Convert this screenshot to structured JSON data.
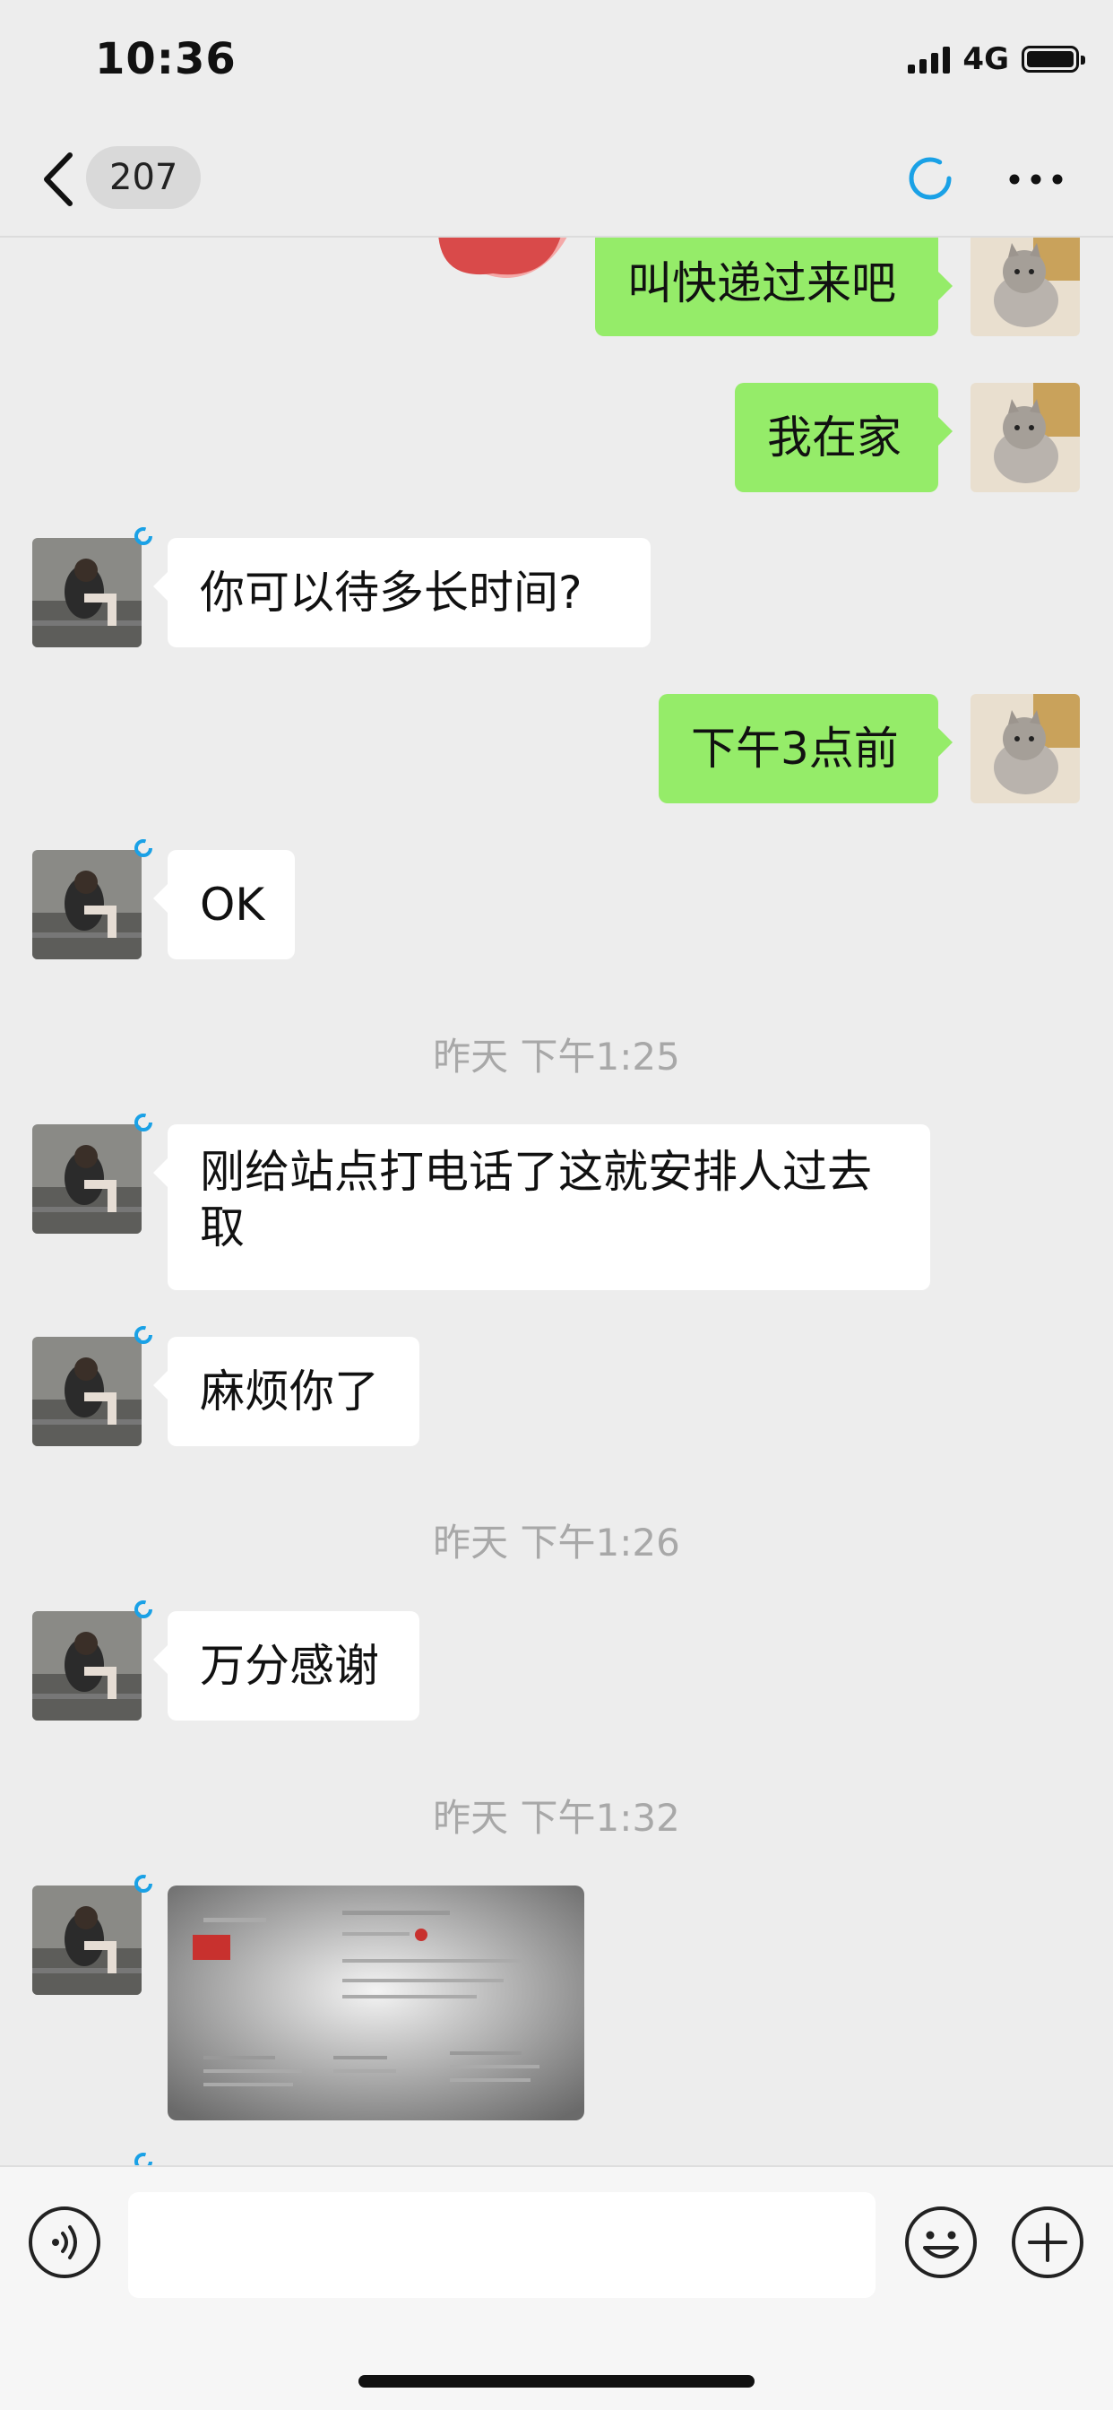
{
  "status_bar": {
    "time": "10:36",
    "network": "4G"
  },
  "nav": {
    "unread_count": "207"
  },
  "messages": [
    {
      "side": "out",
      "text": "叫快递过来吧"
    },
    {
      "side": "out",
      "text": "我在家"
    },
    {
      "side": "in",
      "text": "你可以待多长时间?"
    },
    {
      "side": "out",
      "text": "下午3点前"
    },
    {
      "side": "in",
      "text": "OK"
    },
    {
      "type": "time",
      "text": "昨天 下午1:25"
    },
    {
      "side": "in",
      "text": "刚给站点打电话了这就安排人过去取"
    },
    {
      "side": "in",
      "text": "麻烦你了"
    },
    {
      "type": "time",
      "text": "昨天 下午1:26"
    },
    {
      "side": "in",
      "text": "万分感谢"
    },
    {
      "type": "time",
      "text": "昨天 下午1:32"
    },
    {
      "side": "in",
      "type": "image"
    }
  ],
  "input": {
    "value": ""
  },
  "icons": {
    "back": "chevron-left-icon",
    "loading": "loading-ring-icon",
    "more": "more-dots-icon",
    "voice": "voice-icon",
    "emoji": "emoji-icon",
    "plus": "plus-icon"
  },
  "colors": {
    "bubble_out": "#95ec69",
    "bubble_in": "#ffffff",
    "background": "#ededed",
    "timestamp": "#a8a8a8",
    "status_ring": "#1aa1e6"
  }
}
